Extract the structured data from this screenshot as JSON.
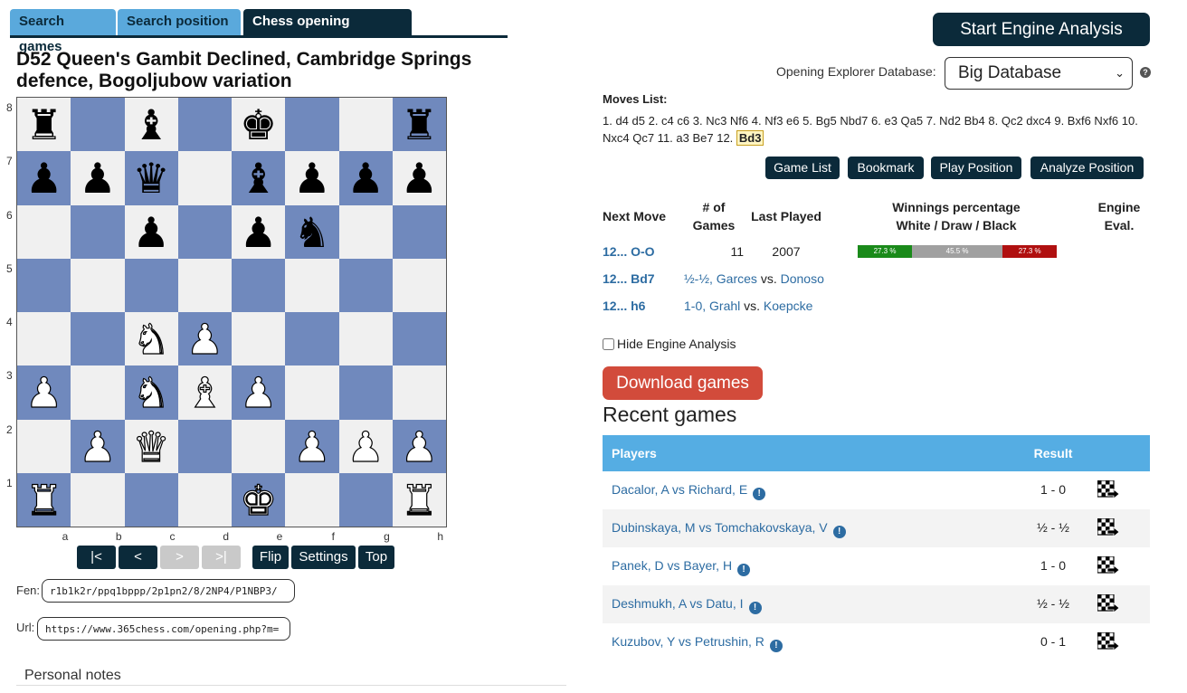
{
  "tabs": [
    {
      "label": "Search games",
      "active": false
    },
    {
      "label": "Search position",
      "active": false
    },
    {
      "label": "Chess opening explorer",
      "active": true
    }
  ],
  "opening_title": "D52 Queen's Gambit Declined, Cambridge Springs defence, Bogoljubow variation",
  "board": {
    "pieces": [
      {
        "sq": "a8",
        "p": "♜",
        "c": "b"
      },
      {
        "sq": "c8",
        "p": "♝",
        "c": "b"
      },
      {
        "sq": "e8",
        "p": "♚",
        "c": "b"
      },
      {
        "sq": "h8",
        "p": "♜",
        "c": "b"
      },
      {
        "sq": "a7",
        "p": "♟",
        "c": "b"
      },
      {
        "sq": "b7",
        "p": "♟",
        "c": "b"
      },
      {
        "sq": "c7",
        "p": "♛",
        "c": "b"
      },
      {
        "sq": "e7",
        "p": "♝",
        "c": "b"
      },
      {
        "sq": "f7",
        "p": "♟",
        "c": "b"
      },
      {
        "sq": "g7",
        "p": "♟",
        "c": "b"
      },
      {
        "sq": "h7",
        "p": "♟",
        "c": "b"
      },
      {
        "sq": "c6",
        "p": "♟",
        "c": "b"
      },
      {
        "sq": "e6",
        "p": "♟",
        "c": "b"
      },
      {
        "sq": "f6",
        "p": "♞",
        "c": "b"
      },
      {
        "sq": "c4",
        "p": "♞",
        "c": "w"
      },
      {
        "sq": "d4",
        "p": "♟",
        "c": "w"
      },
      {
        "sq": "a3",
        "p": "♟",
        "c": "w"
      },
      {
        "sq": "c3",
        "p": "♞",
        "c": "w"
      },
      {
        "sq": "d3",
        "p": "♝",
        "c": "w"
      },
      {
        "sq": "e3",
        "p": "♟",
        "c": "w"
      },
      {
        "sq": "b2",
        "p": "♟",
        "c": "w"
      },
      {
        "sq": "c2",
        "p": "♛",
        "c": "w"
      },
      {
        "sq": "f2",
        "p": "♟",
        "c": "w"
      },
      {
        "sq": "g2",
        "p": "♟",
        "c": "w"
      },
      {
        "sq": "h2",
        "p": "♟",
        "c": "w"
      },
      {
        "sq": "a1",
        "p": "♜",
        "c": "w"
      },
      {
        "sq": "e1",
        "p": "♚",
        "c": "w"
      },
      {
        "sq": "h1",
        "p": "♜",
        "c": "w"
      }
    ],
    "ranks": [
      "8",
      "7",
      "6",
      "5",
      "4",
      "3",
      "2",
      "1"
    ],
    "files": [
      "a",
      "b",
      "c",
      "d",
      "e",
      "f",
      "g",
      "h"
    ],
    "light_color": "#f0f0f0",
    "dark_color": "#7089bd"
  },
  "nav": {
    "first": "|<",
    "prev": "<",
    "next": ">",
    "last": ">|",
    "flip": "Flip",
    "settings": "Settings",
    "top": "Top"
  },
  "fen": {
    "label": "Fen:",
    "value": "r1b1k2r/ppq1bppp/2p1pn2/8/2NP4/P1NBP3/"
  },
  "url": {
    "label": "Url:",
    "value": "https://www.365chess.com/opening.php?m="
  },
  "notes_title": "Personal notes",
  "engine_button": "Start Engine Analysis",
  "db": {
    "label": "Opening Explorer Database:",
    "selected": "Big Database"
  },
  "moves": {
    "title": "Moves List:",
    "text": "1. d4 d5 2. c4 c6 3. Nc3 Nf6 4. Nf3 e6 5. Bg5 Nbd7 6. e3 Qa5 7. Nd2 Bb4 8. Qc2 dxc4 9. Bxf6 Nxf6 10. Nxc4 Qc7 11. a3 Be7 12.",
    "current": "Bd3"
  },
  "actions": {
    "game_list": "Game List",
    "bookmark": "Bookmark",
    "play": "Play Position",
    "analyze": "Analyze Position"
  },
  "explorer_headers": {
    "next_move": "Next Move",
    "num_games_1": "# of",
    "num_games_2": "Games",
    "last_played": "Last Played",
    "winnings_1": "Winnings percentage",
    "winnings_2": "White / Draw / Black",
    "engine_1": "Engine",
    "engine_2": "Eval."
  },
  "explorer_rows": [
    {
      "move": "12... O-O",
      "games": "11",
      "last": "2007",
      "white": 27.3,
      "draw": 45.5,
      "black": 27.3,
      "white_label": "27.3 %",
      "draw_label": "45.5 %",
      "black_label": "27.3 %"
    },
    {
      "move": "12... Bd7",
      "result": "½-½",
      "white_player": "Garces",
      "vs": "vs.",
      "black_player": "Donoso"
    },
    {
      "move": "12... h6",
      "result": "1-0",
      "white_player": "Grahl",
      "vs": "vs.",
      "black_player": "Koepcke"
    }
  ],
  "bar_colors": {
    "white": "#1a8a1a",
    "draw": "#a0a0a0",
    "black": "#b01010"
  },
  "hide_engine_label": "Hide Engine Analysis",
  "download_button": "Download games",
  "recent_title": "Recent games",
  "recent_headers": {
    "players": "Players",
    "result": "Result"
  },
  "recent_games": [
    {
      "players": "Dacalor, A vs Richard, E",
      "result": "1 - 0"
    },
    {
      "players": "Dubinskaya, M vs Tomchakovskaya, V",
      "result": "½ - ½"
    },
    {
      "players": "Panek, D vs Bayer, H",
      "result": "1 - 0"
    },
    {
      "players": "Deshmukh, A vs Datu, I",
      "result": "½ - ½"
    },
    {
      "players": "Kuzubov, Y vs Petrushin, R",
      "result": "0 - 1"
    }
  ],
  "icons": {
    "info": "info-icon",
    "help": "help-icon",
    "replay": "board-replay-icon",
    "caret": "chevron-down-icon"
  }
}
